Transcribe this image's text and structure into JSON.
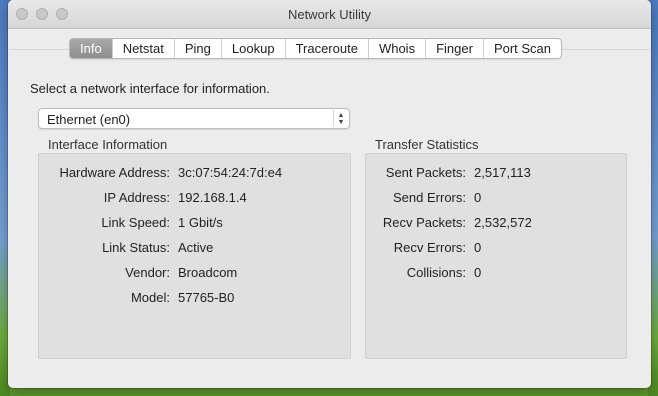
{
  "window": {
    "title": "Network Utility"
  },
  "tabs": [
    "Info",
    "Netstat",
    "Ping",
    "Lookup",
    "Traceroute",
    "Whois",
    "Finger",
    "Port Scan"
  ],
  "prompt": "Select a network interface for information.",
  "interface_select": {
    "value": "Ethernet (en0)"
  },
  "interface_info": {
    "title": "Interface Information",
    "rows": [
      {
        "label": "Hardware Address:",
        "value": "3c:07:54:24:7d:e4"
      },
      {
        "label": "IP Address:",
        "value": "192.168.1.4"
      },
      {
        "label": "Link Speed:",
        "value": "1 Gbit/s"
      },
      {
        "label": "Link Status:",
        "value": "Active"
      },
      {
        "label": "Vendor:",
        "value": "Broadcom"
      },
      {
        "label": "Model:",
        "value": "57765-B0"
      }
    ]
  },
  "transfer_stats": {
    "title": "Transfer Statistics",
    "rows": [
      {
        "label": "Sent Packets:",
        "value": "2,517,113"
      },
      {
        "label": "Send Errors:",
        "value": "0"
      },
      {
        "label": "Recv Packets:",
        "value": "2,532,572"
      },
      {
        "label": "Recv Errors:",
        "value": "0"
      },
      {
        "label": "Collisions:",
        "value": "0"
      }
    ]
  },
  "colors": {
    "active_tab": "#9a9a9a",
    "window_bg": "#ececec",
    "group_bg": "#e0e0e0"
  },
  "icons": {
    "popup_arrows": "up-down-chevron-icon"
  }
}
